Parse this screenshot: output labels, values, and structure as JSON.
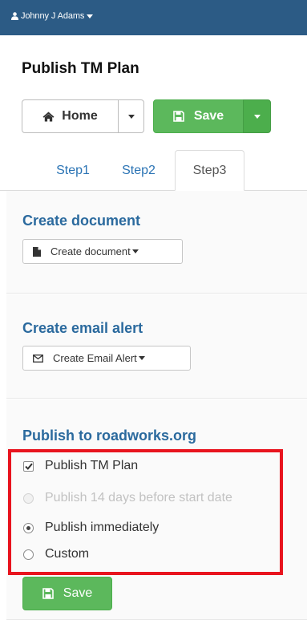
{
  "header": {
    "user_name": "Johnny J Adams",
    "bg_color": "#2c5b85"
  },
  "page": {
    "title": "Publish TM Plan"
  },
  "toolbar": {
    "home_label": "Home",
    "save_label": "Save"
  },
  "tabs": [
    {
      "label": "Step1",
      "active": false
    },
    {
      "label": "Step2",
      "active": false
    },
    {
      "label": "Step3",
      "active": true
    }
  ],
  "sections": {
    "create_document": {
      "title": "Create document",
      "button_label": "Create document"
    },
    "create_email_alert": {
      "title": "Create email alert",
      "button_label": "Create Email Alert"
    },
    "publish": {
      "title": "Publish to roadworks.org",
      "checkbox_label": "Publish TM Plan",
      "checkbox_checked": true,
      "options": [
        {
          "label": "Publish 14 days before start date",
          "selected": false,
          "disabled": true
        },
        {
          "label": "Publish immediately",
          "selected": true,
          "disabled": false
        },
        {
          "label": "Custom",
          "selected": false,
          "disabled": false
        }
      ],
      "save_label": "Save"
    }
  },
  "colors": {
    "accent_blue": "#2b6a9e",
    "success": "#5cb85c",
    "highlight": "#e8141e"
  },
  "icons": {
    "user": "user-icon",
    "home": "home-icon",
    "save": "floppy-disk-icon",
    "document": "file-icon",
    "email": "envelope-icon"
  }
}
